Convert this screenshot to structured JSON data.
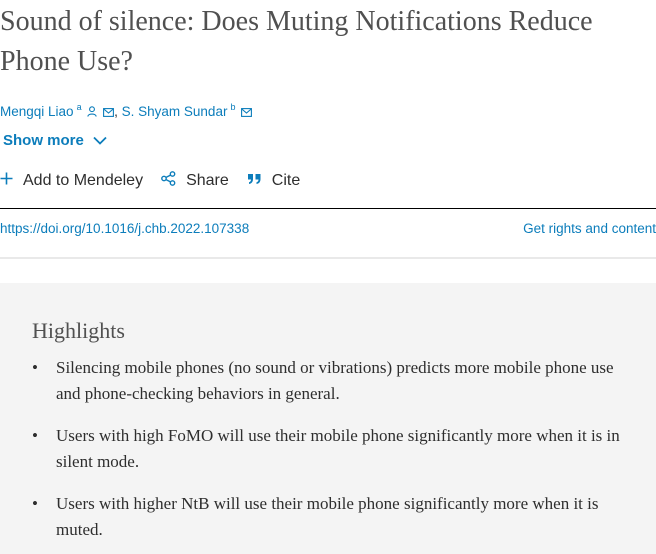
{
  "article": {
    "title": "Sound of silence: Does Muting Notifications Reduce Phone Use?"
  },
  "authors": [
    {
      "name": "Mengqi Liao",
      "sup": "a",
      "icons": [
        "person-icon",
        "email-icon"
      ]
    },
    {
      "name": "S. Shyam Sundar",
      "sup": "b",
      "icons": [
        "email-icon"
      ]
    }
  ],
  "author_separator": ",",
  "show_more": {
    "label": "Show more",
    "icon": "chevron-down-icon"
  },
  "actions": [
    {
      "label": "Add to Mendeley",
      "icon": "plus-icon"
    },
    {
      "label": "Share",
      "icon": "share-icon"
    },
    {
      "label": "Cite",
      "icon": "quote-icon"
    }
  ],
  "links": {
    "doi": "https://doi.org/10.1016/j.chb.2022.107338",
    "rights": "Get rights and content"
  },
  "highlights": {
    "heading": "Highlights",
    "bullet": "•",
    "items": [
      "Silencing mobile phones (no sound or vibrations) predicts more mobile phone use and phone-checking behaviors in general.",
      "Users with high FoMO will use their mobile phone significantly more when it is in silent mode.",
      "Users with higher NtB will use their mobile phone significantly more when it is muted."
    ]
  },
  "colors": {
    "link": "#0c7dbb",
    "text": "#2e2e2e",
    "title": "#505050",
    "highlights_bg": "#f4f4f4"
  }
}
